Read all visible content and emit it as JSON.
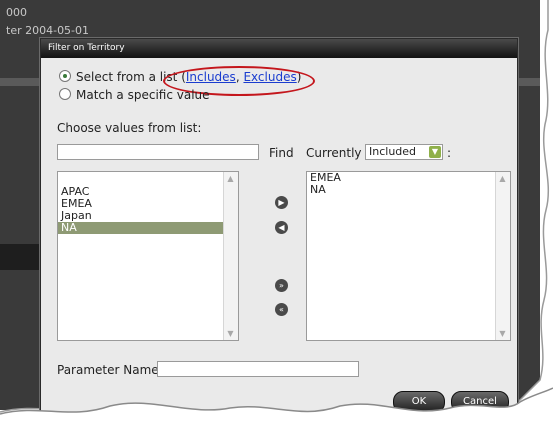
{
  "background": {
    "line1": "000",
    "line2": "ter 2004-05-01"
  },
  "dialog": {
    "title": "Filter on Territory",
    "radio_list_label": "Select from a list ",
    "paren_open": "(",
    "link_includes": "Includes",
    "comma": ", ",
    "link_excludes": "Excludes",
    "paren_close": ")",
    "radio_match_label": "Match a specific value",
    "choose_label": "Choose values from list:",
    "find_label": "Find",
    "currently_label": "Currently",
    "currently_value": "Included",
    "colon": ":",
    "available_items": [
      "APAC",
      "EMEA",
      "Japan",
      "NA"
    ],
    "selected_available": "NA",
    "current_items": [
      "EMEA",
      "NA"
    ],
    "param_label": "Parameter Name:",
    "param_value": "",
    "ok_label": "OK",
    "cancel_label": "Cancel"
  },
  "colors": {
    "annotation": "#c4161c",
    "selection": "#8e9a74",
    "dropdown_accent": "#8fb04a"
  }
}
